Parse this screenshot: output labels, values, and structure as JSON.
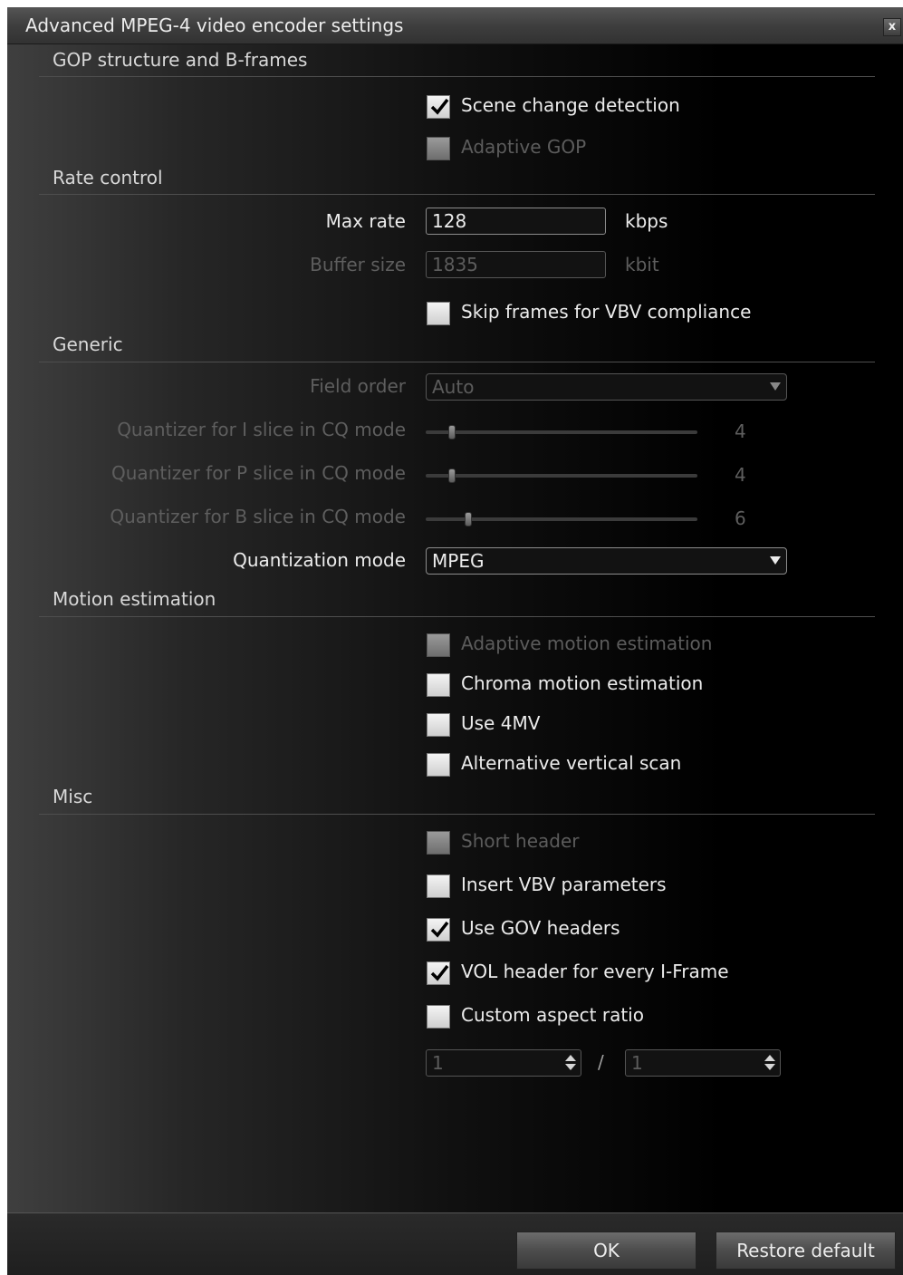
{
  "window": {
    "title": "Advanced MPEG-4 video encoder settings",
    "close_label": "x"
  },
  "sections": {
    "gop": "GOP structure and B-frames",
    "rate": "Rate control",
    "generic": "Generic",
    "motion": "Motion estimation",
    "misc": "Misc"
  },
  "gop": {
    "scene_change": {
      "label": "Scene change detection",
      "checked": true,
      "enabled": true
    },
    "adaptive_gop": {
      "label": "Adaptive GOP",
      "checked": false,
      "enabled": false
    }
  },
  "rate": {
    "max_rate_label": "Max rate",
    "max_rate_value": "128",
    "max_rate_unit": "kbps",
    "buffer_size_label": "Buffer size",
    "buffer_size_value": "1835",
    "buffer_size_unit": "kbit",
    "skip_frames": {
      "label": "Skip frames for VBV compliance",
      "checked": false,
      "enabled": true
    }
  },
  "generic": {
    "field_order_label": "Field order",
    "field_order_value": "Auto",
    "quant_i_label": "Quantizer for I slice in CQ mode",
    "quant_i_value": "4",
    "quant_p_label": "Quantizer for P slice in CQ mode",
    "quant_p_value": "4",
    "quant_b_label": "Quantizer for B slice in CQ mode",
    "quant_b_value": "6",
    "quant_mode_label": "Quantization mode",
    "quant_mode_value": "MPEG"
  },
  "motion": {
    "adaptive_me": {
      "label": "Adaptive motion estimation",
      "checked": false,
      "enabled": false
    },
    "chroma_me": {
      "label": "Chroma motion estimation",
      "checked": false,
      "enabled": true
    },
    "use_4mv": {
      "label": "Use 4MV",
      "checked": false,
      "enabled": true
    },
    "alt_scan": {
      "label": "Alternative vertical scan",
      "checked": false,
      "enabled": true
    }
  },
  "misc": {
    "short_header": {
      "label": "Short header",
      "checked": false,
      "enabled": false
    },
    "insert_vbv": {
      "label": "Insert VBV parameters",
      "checked": false,
      "enabled": true
    },
    "gov_headers": {
      "label": "Use GOV headers",
      "checked": true,
      "enabled": true
    },
    "vol_header": {
      "label": "VOL header for every I-Frame",
      "checked": true,
      "enabled": true
    },
    "custom_aspect": {
      "label": "Custom aspect ratio",
      "checked": false,
      "enabled": true
    },
    "aspect_num": "1",
    "aspect_separator": "/",
    "aspect_den": "1"
  },
  "footer": {
    "ok_label": "OK",
    "restore_label": "Restore default"
  },
  "colors": {
    "text": "#ececec",
    "disabled_text": "#5c5c5c",
    "dialog_dark": "#000000",
    "dialog_light": "#3f3f3f",
    "rule": "#4e4e4e"
  }
}
